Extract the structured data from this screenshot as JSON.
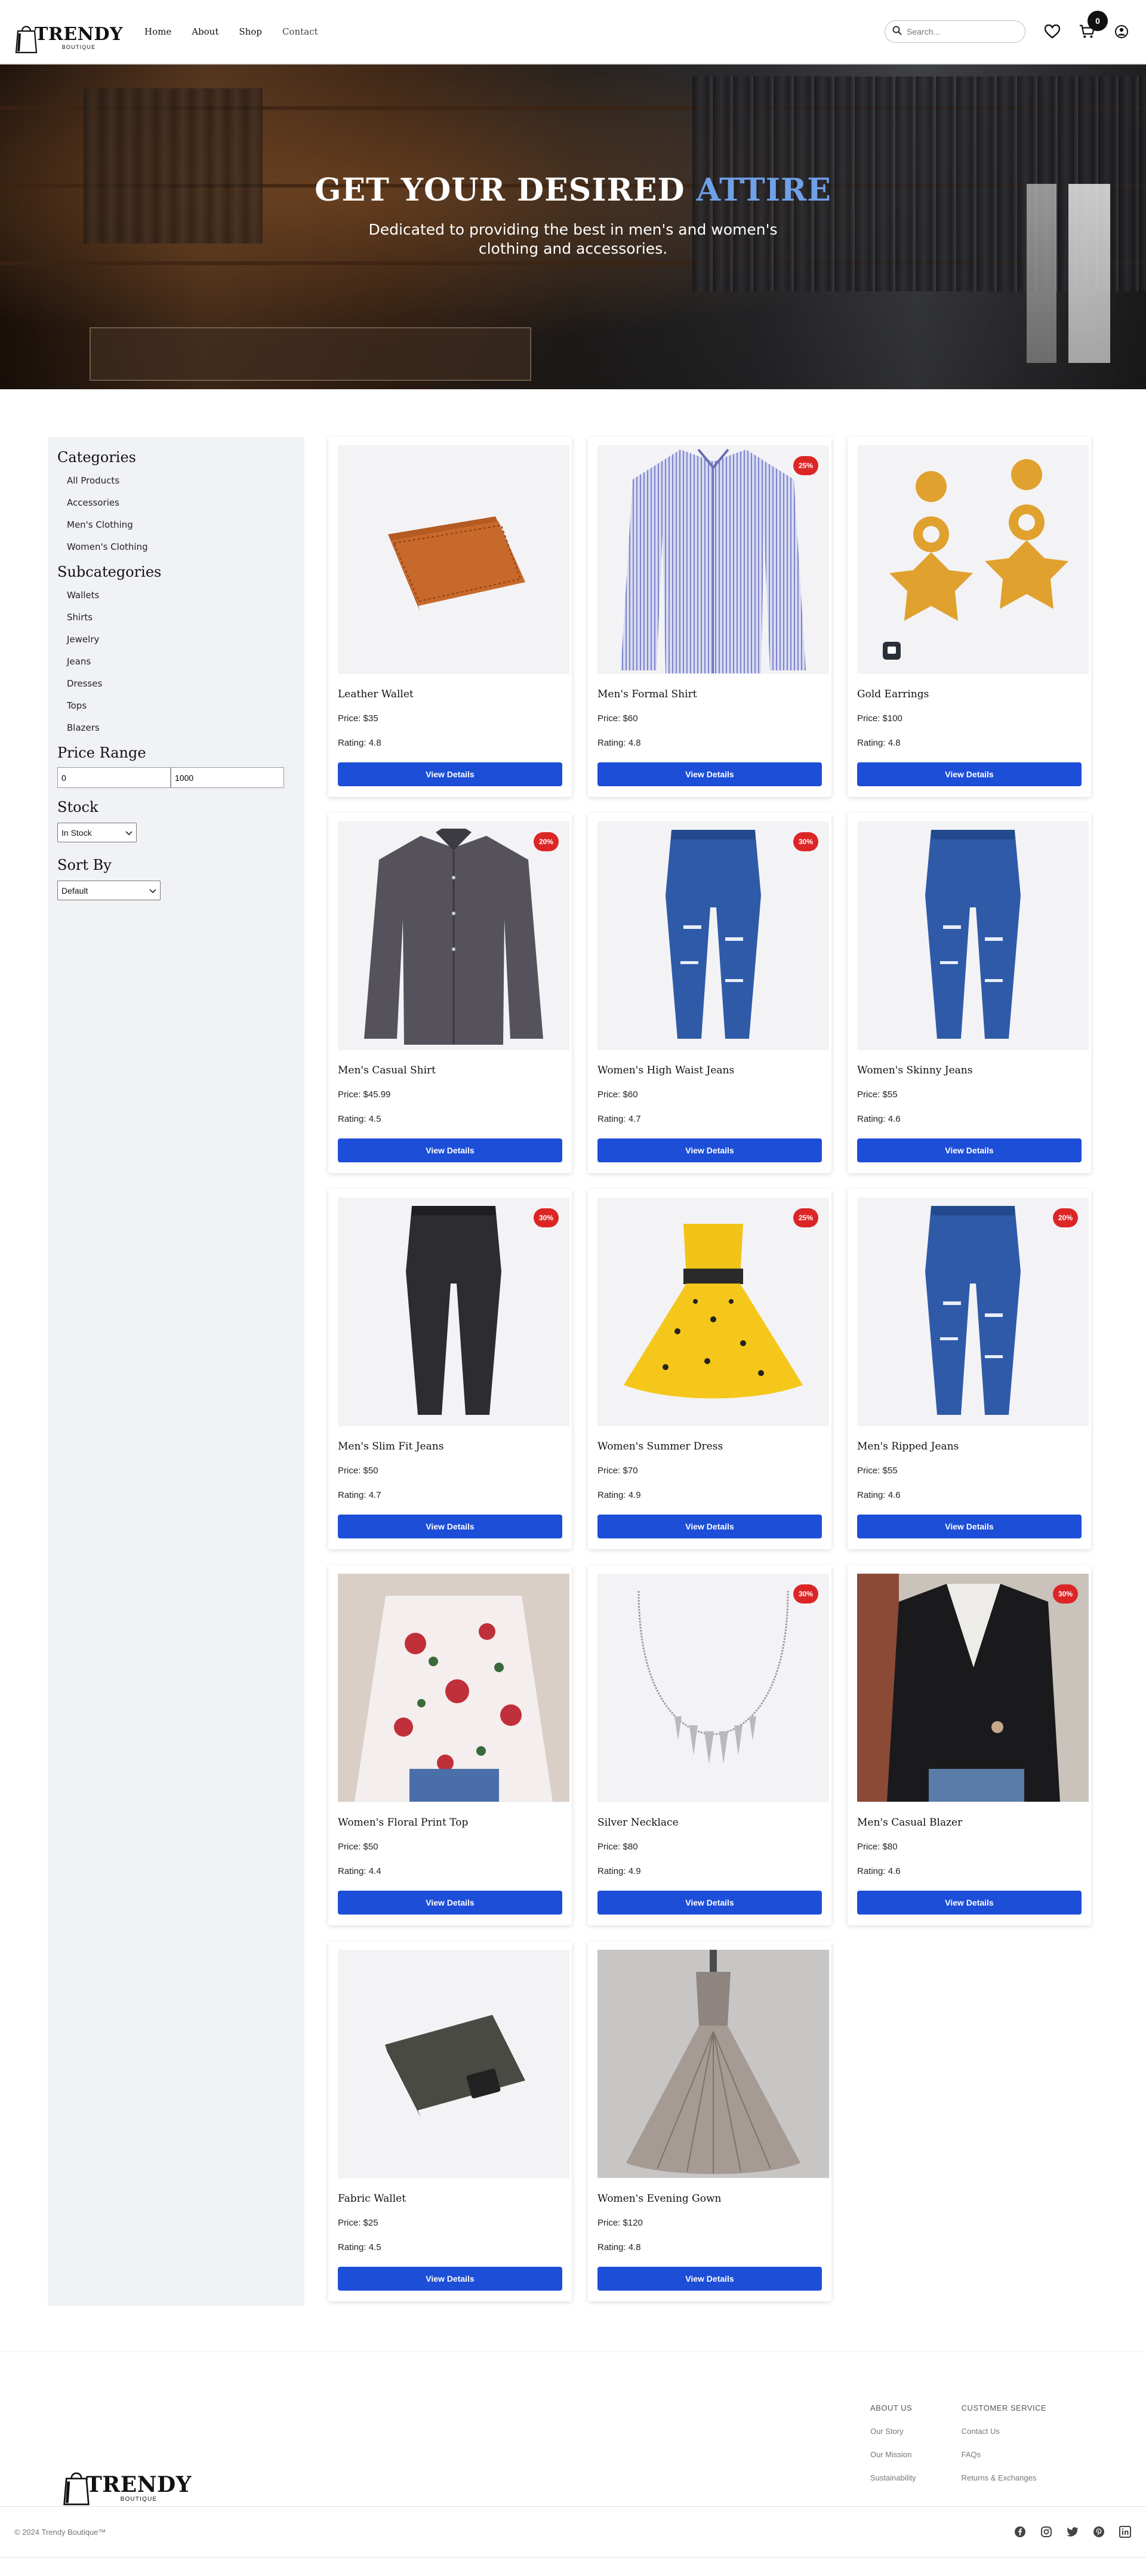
{
  "header": {
    "logo_brand": "TRENDY",
    "logo_sub": "BOUTIQUE",
    "nav": [
      "Home",
      "About",
      "Shop",
      "Contact"
    ],
    "search_placeholder": "Search...",
    "cart_count": "0"
  },
  "hero": {
    "title_main": "GET YOUR DESIRED ",
    "title_accent": "ATTIRE",
    "subtitle": "Dedicated to providing the best in men's and women's clothing and accessories."
  },
  "sidebar": {
    "categories_title": "Categories",
    "categories": [
      "All Products",
      "Accessories",
      "Men's Clothing",
      "Women's Clothing"
    ],
    "subcategories_title": "Subcategories",
    "subcategories": [
      "Wallets",
      "Shirts",
      "Jewelry",
      "Jeans",
      "Dresses",
      "Tops",
      "Blazers"
    ],
    "price_title": "Price Range",
    "price_min": "0",
    "price_max": "1000",
    "stock_title": "Stock",
    "stock_value": "In Stock",
    "sort_title": "Sort By",
    "sort_value": "Default"
  },
  "products": [
    {
      "name": "Leather Wallet",
      "price": "Price: $35",
      "rating": "Rating: 4.8",
      "badge": "",
      "button": "View Details",
      "icon": "wallet-icon"
    },
    {
      "name": "Men's Formal Shirt",
      "price": "Price: $60",
      "rating": "Rating: 4.8",
      "badge": "25%",
      "button": "View Details",
      "icon": "shirt-icon"
    },
    {
      "name": "Gold Earrings",
      "price": "Price: $100",
      "rating": "Rating: 4.8",
      "badge": "",
      "button": "View Details",
      "icon": "earrings-icon"
    },
    {
      "name": "Men's Casual Shirt",
      "price": "Price: $45.99",
      "rating": "Rating: 4.5",
      "badge": "20%",
      "button": "View Details",
      "icon": "shirt-icon"
    },
    {
      "name": "Women's High Waist Jeans",
      "price": "Price: $60",
      "rating": "Rating: 4.7",
      "badge": "30%",
      "button": "View Details",
      "icon": "jeans-icon"
    },
    {
      "name": "Women's Skinny Jeans",
      "price": "Price: $55",
      "rating": "Rating: 4.6",
      "badge": "",
      "button": "View Details",
      "icon": "jeans-icon"
    },
    {
      "name": "Men's Slim Fit Jeans",
      "price": "Price: $50",
      "rating": "Rating: 4.7",
      "badge": "30%",
      "button": "View Details",
      "icon": "jeans-icon"
    },
    {
      "name": "Women's Summer Dress",
      "price": "Price: $70",
      "rating": "Rating: 4.9",
      "badge": "25%",
      "button": "View Details",
      "icon": "dress-icon"
    },
    {
      "name": "Men's Ripped Jeans",
      "price": "Price: $55",
      "rating": "Rating: 4.6",
      "badge": "20%",
      "button": "View Details",
      "icon": "jeans-icon"
    },
    {
      "name": "Women's Floral Print Top",
      "price": "Price: $50",
      "rating": "Rating: 4.4",
      "badge": "",
      "button": "View Details",
      "icon": "top-icon"
    },
    {
      "name": "Silver Necklace",
      "price": "Price: $80",
      "rating": "Rating: 4.9",
      "badge": "30%",
      "button": "View Details",
      "icon": "necklace-icon"
    },
    {
      "name": "Men's Casual Blazer",
      "price": "Price: $80",
      "rating": "Rating: 4.6",
      "badge": "30%",
      "button": "View Details",
      "icon": "blazer-icon"
    },
    {
      "name": "Fabric Wallet",
      "price": "Price: $25",
      "rating": "Rating: 4.5",
      "badge": "",
      "button": "View Details",
      "icon": "wallet-icon"
    },
    {
      "name": "Women's Evening Gown",
      "price": "Price: $120",
      "rating": "Rating: 4.8",
      "badge": "",
      "button": "View Details",
      "icon": "gown-icon"
    }
  ],
  "footer": {
    "about_title": "ABOUT US",
    "about_links": [
      "Our Story",
      "Our Mission",
      "Sustainability"
    ],
    "service_title": "CUSTOMER SERVICE",
    "service_links": [
      "Contact Us",
      "FAQs",
      "Returns & Exchanges"
    ],
    "copyright": "© 2024 Trendy Boutique™",
    "socials": [
      "facebook-icon",
      "instagram-icon",
      "twitter-icon",
      "pinterest-icon",
      "linkedin-icon"
    ]
  },
  "colors": {
    "accent": "#1d4ed8",
    "badge": "#dc2626",
    "hero_accent": "#6fa0e8"
  }
}
